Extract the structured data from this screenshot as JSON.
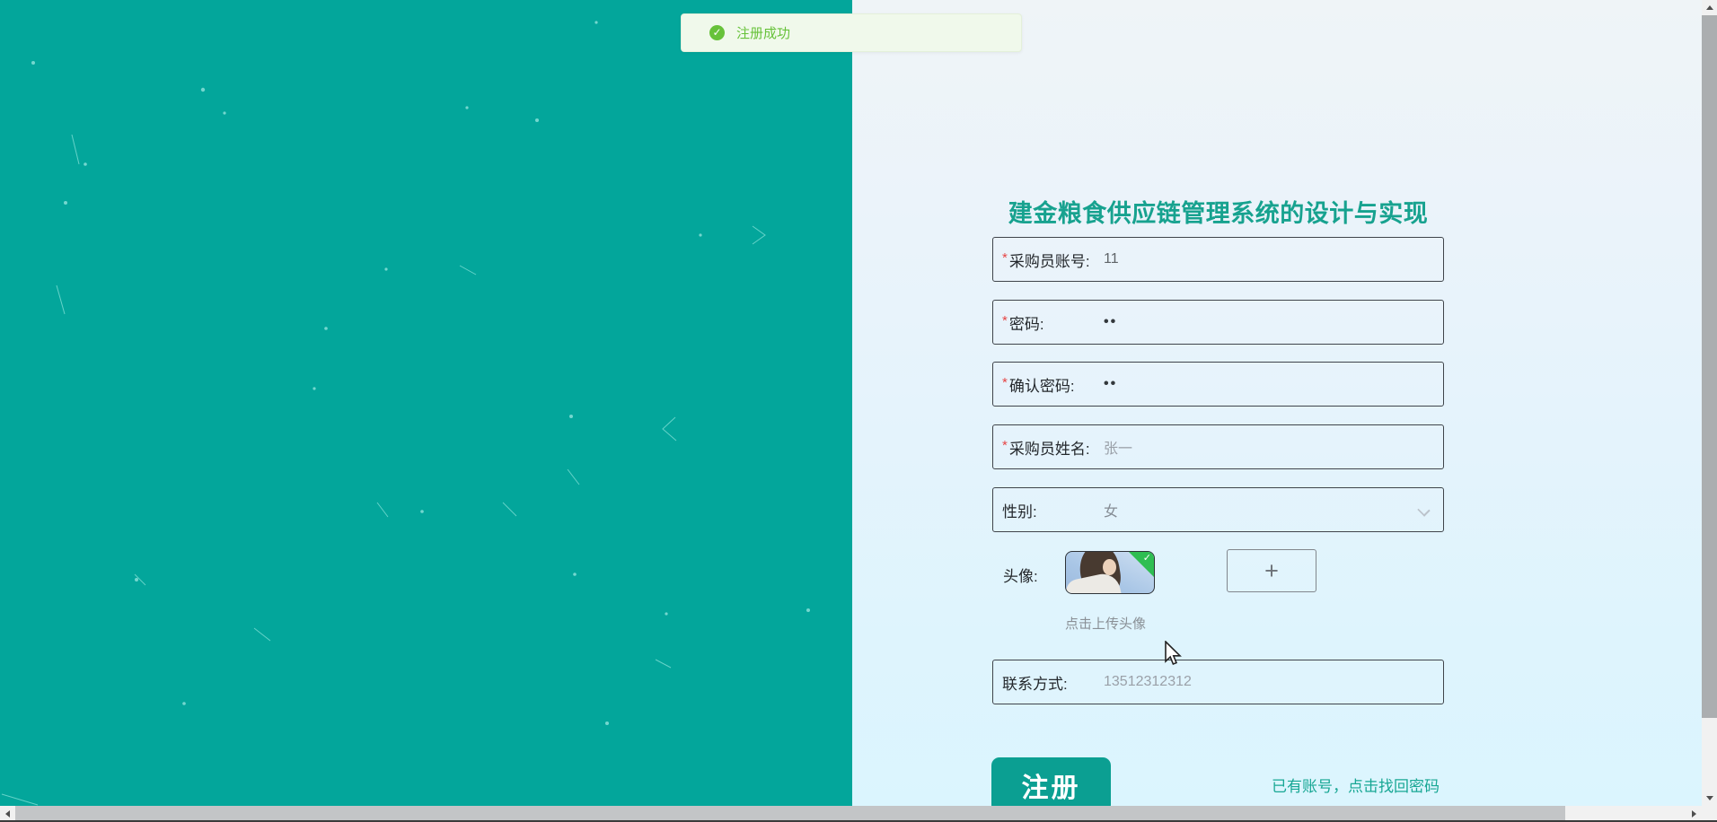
{
  "toast": {
    "message": "注册成功"
  },
  "form": {
    "title": "建金粮食供应链管理系统的设计与实现",
    "required_marker": "*",
    "fields": [
      {
        "label": "采购员账号:",
        "value": "11"
      },
      {
        "label": "密码:",
        "value": "••"
      },
      {
        "label": "确认密码:",
        "value": "••"
      },
      {
        "label": "采购员姓名:",
        "value": "张一"
      },
      {
        "label": "性别:",
        "value": "女"
      }
    ],
    "avatar": {
      "label": "头像:",
      "plus": "+",
      "hint": "点击上传头像",
      "badge_check": "✓"
    },
    "contact": {
      "label": "联系方式:",
      "value": "13512312312"
    },
    "register_label": "注册",
    "login_link": "已有账号，点击找回密码"
  },
  "toast_icon_glyph": "✓",
  "colors": {
    "teal_panel": "#03a69b",
    "accent": "#0b9f92",
    "title": "#17a28f",
    "link": "#18a794",
    "success": "#67c23a",
    "success_bg": "#f0f9eb",
    "field_border": "#3f444a",
    "required": "#e64545"
  }
}
